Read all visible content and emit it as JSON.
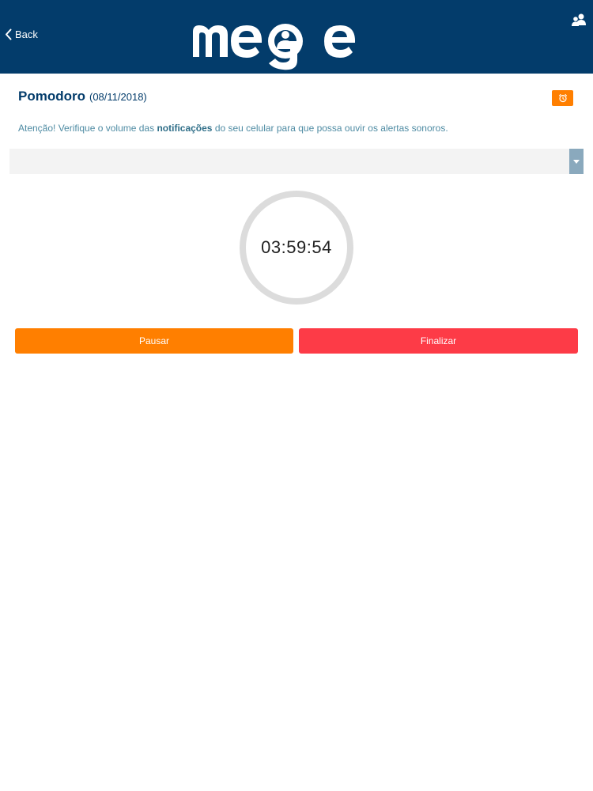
{
  "header": {
    "back_label": "Back",
    "logo_text": "mege",
    "bg_color": "#033c6b"
  },
  "page": {
    "title": "Pomodoro",
    "date": "(08/11/2018)"
  },
  "notice": {
    "before": "Atenção! Verifique o volume das ",
    "bold": "notificações",
    "after": " do seu celular para que possa ouvir os alertas sonoros."
  },
  "select": {
    "value": ""
  },
  "timer": {
    "display": "03:59:54"
  },
  "buttons": {
    "pause_label": "Pausar",
    "finish_label": "Finalizar"
  },
  "colors": {
    "accent_orange": "#ff7f00",
    "danger_red": "#fd3b47",
    "brand_blue": "#033c6b"
  },
  "icons": {
    "back": "chevron-left-icon",
    "profile": "users-icon",
    "alarm": "alarm-clock-icon",
    "dropdown": "caret-down-icon"
  }
}
